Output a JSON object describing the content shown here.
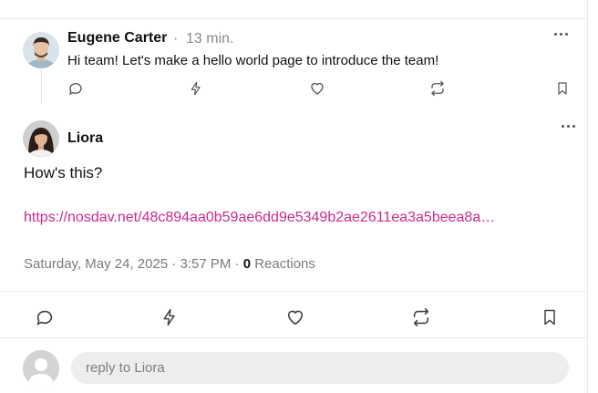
{
  "parent_post": {
    "author": "Eugene Carter",
    "time": "13 min.",
    "text": "Hi team! Let's make a hello world page to introduce the team!",
    "actions": [
      "reply-icon",
      "zap-icon",
      "heart-icon",
      "repost-icon",
      "bookmark-icon"
    ]
  },
  "main_post": {
    "author": "Liora",
    "text": "How's this?",
    "link": "https://nosdav.net/48c894aa0b59ae6dd9e5349b2ae2611ea3a5beea8a…",
    "date": "Saturday, May 24, 2025 · 3:57 PM · ",
    "reaction_count": "0",
    "reactions_label": " Reactions",
    "actions": [
      "reply-icon",
      "zap-icon",
      "heart-icon",
      "repost-icon",
      "bookmark-icon"
    ]
  },
  "reply": {
    "placeholder": "reply to Liora"
  },
  "colors": {
    "link": "#cc2a8c",
    "muted": "#8a8a8a",
    "input_bg": "#ededed"
  }
}
